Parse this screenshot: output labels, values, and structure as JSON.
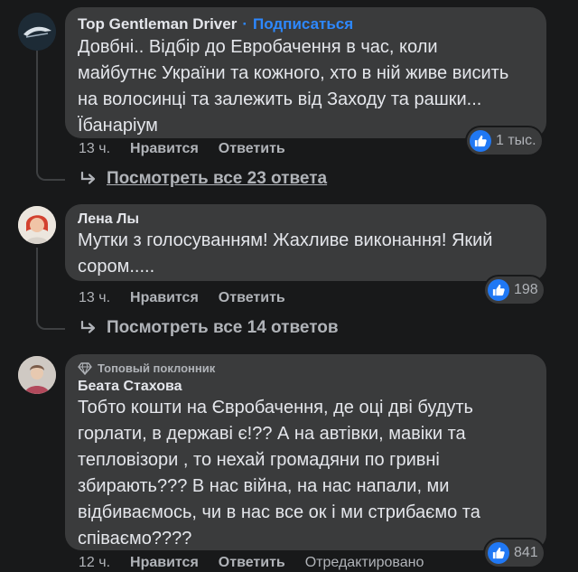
{
  "comments": [
    {
      "author": "Top Gentleman Driver",
      "subscribe": "Подписаться",
      "text": "Довбні.. Відбір до Евробачення в час, коли\nмайбутнє України та кожного, хто в ній живе висить\nна волосинці та залежить від Заходу та рашки...\nЇбанаріум",
      "time": "13 ч.",
      "like": "Нравится",
      "reply": "Ответить",
      "reactions": "1 тыс.",
      "view_replies": "Посмотреть все 23 ответа"
    },
    {
      "author": "Лена Лы",
      "text": "Мутки з голосуванням! Жахливе виконання! Який\nсором.....",
      "time": "13 ч.",
      "like": "Нравится",
      "reply": "Ответить",
      "reactions": "198",
      "view_replies": "Посмотреть все 14 ответов"
    },
    {
      "badge": "Топовый поклонник",
      "author": "Беата Стахова",
      "text": "Тобто кошти на Євробачення, де оці дві будуть\nгорлати, в державі є!?? А на автівки, мавіки та\nтепловізори , то нехай громадяни по гривні\nзбирають??? В нас війна, на нас напали, ми\nвідбиваємось, чи в нас все ок і ми стрибаємо та\nспіваємо????",
      "time": "12 ч.",
      "like": "Нравится",
      "reply": "Ответить",
      "edited": "Отредактировано",
      "reactions": "841"
    }
  ],
  "icons": {
    "like": "thumbs-up-icon",
    "reply_arrow": "reply-arrow-icon",
    "badge": "diamond-icon"
  },
  "colors": {
    "background": "#18191a",
    "bubble": "#3a3b3c",
    "link_blue": "#2d88ff",
    "like_blue": "#2078f4",
    "secondary_text": "#b0b3b8"
  }
}
